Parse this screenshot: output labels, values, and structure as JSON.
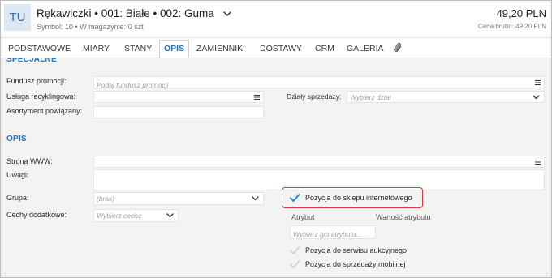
{
  "header": {
    "avatar_initials": "TU",
    "title": "Rękawiczki • 001: Białe • 002: Guma",
    "subtitle": "Symbol: 10 • W magazynie: 0 szt",
    "price": "49,20 PLN",
    "price_gross": "Cena brutto: 49,20 PLN"
  },
  "tabs": [
    {
      "label": "PODSTAWOWE",
      "active": false
    },
    {
      "label": "MIARY",
      "active": false
    },
    {
      "label": "STANY",
      "active": false
    },
    {
      "label": "OPIS",
      "active": true
    },
    {
      "label": "ZAMIENNIKI",
      "active": false
    },
    {
      "label": "DOSTAWY",
      "active": false
    },
    {
      "label": "CRM",
      "active": false
    },
    {
      "label": "GALERIA",
      "active": false
    }
  ],
  "specjalne": {
    "title": "SPECJALNE",
    "fundusz_promocji": {
      "label": "Fundusz promocji:",
      "value": "",
      "placeholder": "Podaj fundusz promocji"
    },
    "usluga_recyklingowa": {
      "label": "Usługa recyklingowa:",
      "value": ""
    },
    "dzialy_sprzedazy": {
      "label": "Działy sprzedaży:",
      "placeholder": "Wybierz dział"
    },
    "asortyment_powiazany": {
      "label": "Asortyment powiązany:",
      "value": ""
    }
  },
  "opis": {
    "title": "OPIS",
    "strona_www": {
      "label": "Strona WWW:",
      "value": ""
    },
    "uwagi": {
      "label": "Uwagi:",
      "value": ""
    },
    "grupa": {
      "label": "Grupa:",
      "selected": "(brak)"
    },
    "cechy_dodatkowe": {
      "label": "Cechy dodatkowe:",
      "placeholder": "Wybierz cechę"
    },
    "sklep_internetowy": {
      "label": "Pozycja do sklepu internetowego",
      "checked": true
    },
    "atrybuty": {
      "column_attribute": "Atrybut",
      "column_value": "Wartość atrybutu",
      "type_placeholder": "Wybierz typ atrybutu..."
    },
    "serwis_aukcyjny": {
      "label": "Pozycja do serwisu aukcyjnego",
      "checked": false
    },
    "sprzedaz_mobilna": {
      "label": "Pozycja do sprzedaży mobilnej",
      "checked": false
    }
  },
  "icons": {
    "title_dropdown": "chevron-down-icon",
    "attachments_tab": "paperclip-icon",
    "field_picker": "list-icon",
    "dropdown": "chevron-down-icon",
    "checkbox": "check-icon"
  },
  "colors": {
    "accent": "#1b75c0",
    "highlight": "#d9383a",
    "avatar_bg": "#dce8f3",
    "avatar_text": "#3a6d9c",
    "check_on": "#1e88e5",
    "check_off": "#c7d6e2",
    "content_bg": "#f3f3f3"
  }
}
